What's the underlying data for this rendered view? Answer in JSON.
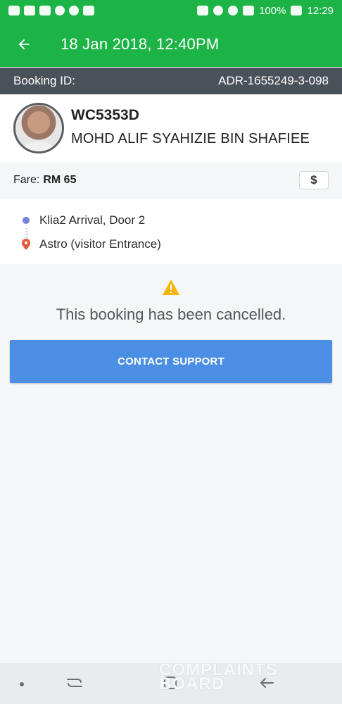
{
  "status": {
    "battery": "100%",
    "time": "12:29"
  },
  "header": {
    "title": "18 Jan 2018, 12:40PM"
  },
  "booking": {
    "label": "Booking ID:",
    "id": "ADR-1655249-3-098"
  },
  "driver": {
    "plate": "WC5353D",
    "name": "MOHD ALIF SYAHIZIE BIN SHAFIEE"
  },
  "fare": {
    "label": "Fare:",
    "value": "RM 65",
    "button_symbol": "$"
  },
  "route": {
    "pickup": "Klia2 Arrival, Door 2",
    "dropoff": "Astro (visitor Entrance)"
  },
  "cancellation": {
    "message": "This booking has been cancelled.",
    "button_label": "CONTACT SUPPORT"
  },
  "watermark": {
    "line1": "COMPLAINTS",
    "line2": "BOARD"
  },
  "icons": {
    "back": "arrow-left-icon",
    "warning": "warning-icon",
    "pickup": "pickup-dot-icon",
    "dropoff": "location-pin-icon"
  },
  "colors": {
    "primary": "#1db447",
    "accent": "#4a8fe3",
    "warning": "#f4b400",
    "pin": "#e35a3a"
  }
}
